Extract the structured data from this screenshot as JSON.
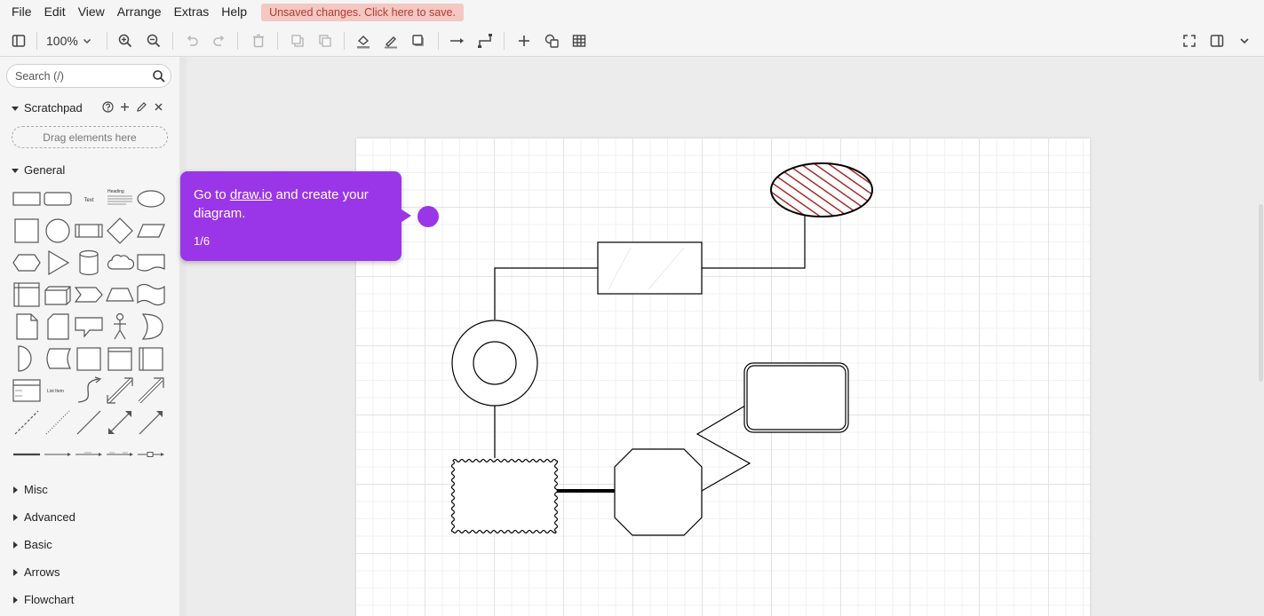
{
  "menubar": {
    "items": [
      {
        "label": "File"
      },
      {
        "label": "Edit"
      },
      {
        "label": "View"
      },
      {
        "label": "Arrange"
      },
      {
        "label": "Extras"
      },
      {
        "label": "Help"
      }
    ],
    "unsaved_label": "Unsaved changes. Click here to save."
  },
  "toolbar": {
    "zoom": "100%"
  },
  "sidebar": {
    "search_placeholder": "Search (/)",
    "scratchpad_label": "Scratchpad",
    "drop_zone_label": "Drag elements here",
    "general_label": "General",
    "shape_labels": {
      "text": "Text",
      "heading": "Heading",
      "list_item": "List Item"
    },
    "sections": [
      {
        "label": "Misc"
      },
      {
        "label": "Advanced"
      },
      {
        "label": "Basic"
      },
      {
        "label": "Arrows"
      },
      {
        "label": "Flowchart"
      }
    ]
  },
  "tour": {
    "text_before": "Go to ",
    "link": "draw.io",
    "text_after": " and create your diagram.",
    "step": "1/6",
    "color": "#9a36e8"
  },
  "colors": {
    "hatch": "#a52a2a",
    "unsaved_bg": "#f4c7c3",
    "unsaved_text": "#b23b33"
  }
}
